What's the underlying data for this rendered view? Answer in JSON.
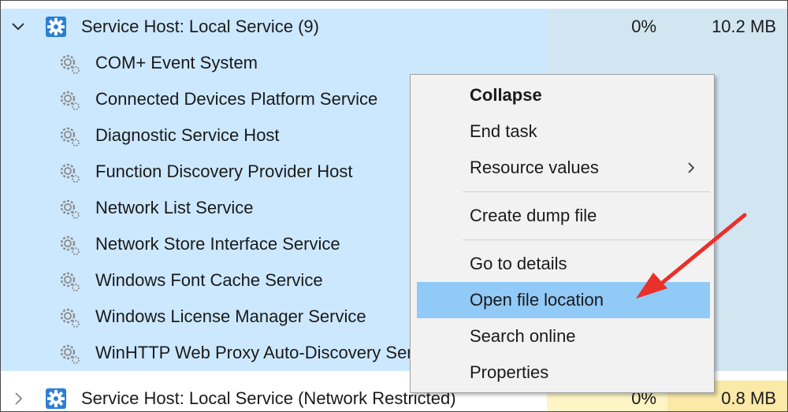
{
  "rows": [
    {
      "kind": "group",
      "label": "Service Host: Local Service (9)",
      "cpu": "0%",
      "memory": "10.2 MB",
      "expanded": true,
      "selected": true
    },
    {
      "kind": "child",
      "label": "COM+ Event System"
    },
    {
      "kind": "child",
      "label": "Connected Devices Platform Service"
    },
    {
      "kind": "child",
      "label": "Diagnostic Service Host"
    },
    {
      "kind": "child",
      "label": "Function Discovery Provider Host"
    },
    {
      "kind": "child",
      "label": "Network List Service"
    },
    {
      "kind": "child",
      "label": "Network Store Interface Service"
    },
    {
      "kind": "child",
      "label": "Windows Font Cache Service"
    },
    {
      "kind": "child",
      "label": "Windows License Manager Service"
    },
    {
      "kind": "child",
      "label": "WinHTTP Web Proxy Auto-Discovery Service"
    },
    {
      "kind": "group",
      "label": "Service Host: Local Service (Network Restricted)",
      "cpu": "0%",
      "memory": "0.8 MB",
      "expanded": false,
      "selected": false
    }
  ],
  "context_menu": {
    "collapse": "Collapse",
    "end_task": "End task",
    "resource_values": "Resource values",
    "create_dump_file": "Create dump file",
    "go_to_details": "Go to details",
    "open_file_location": "Open file location",
    "search_online": "Search online",
    "properties": "Properties",
    "highlighted": "open_file_location"
  },
  "colors": {
    "selection": "#cce8ff",
    "menu_highlight": "#91c9f7",
    "annotation_arrow": "#e8312a",
    "gear_blue": "#2b7fd3"
  },
  "icons": {
    "expand": "chevron-down-icon",
    "collapsed": "chevron-right-icon",
    "service_host": "gear-icon",
    "service": "small-gear-icon",
    "submenu": "chevron-right-icon"
  }
}
